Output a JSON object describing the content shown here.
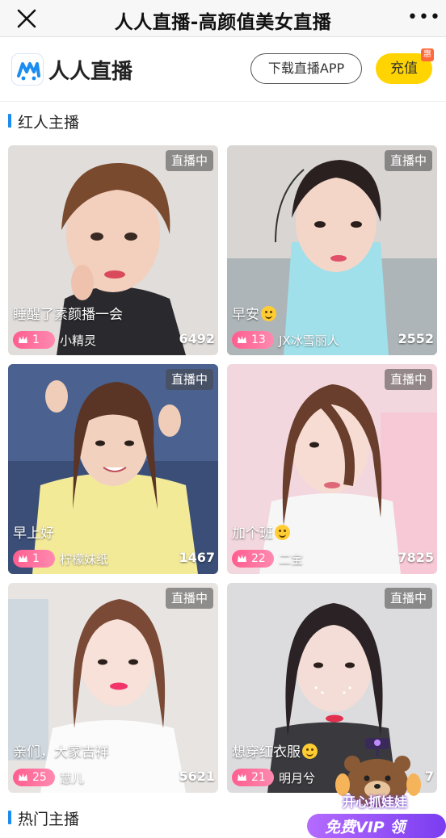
{
  "navbar": {
    "title": "人人直播-高颜值美女直播",
    "more_label": "•••"
  },
  "appbar": {
    "logo_text": "人人直播",
    "download_label": "下载直播APP",
    "recharge_label": "充值",
    "recharge_badge": "惠"
  },
  "sections": {
    "hot_red": "红人主播",
    "popular": "热门主播"
  },
  "cards": [
    {
      "status": "直播中",
      "caption": "睡醒了素颜播一会",
      "emoji": false,
      "level": "1",
      "name": "小精灵",
      "viewers": "6492"
    },
    {
      "status": "直播中",
      "caption": "早安",
      "emoji": true,
      "level": "13",
      "name": "JX冰雪丽人",
      "viewers": "2552"
    },
    {
      "status": "直播中",
      "caption": "早上好",
      "emoji": false,
      "level": "1",
      "name": "柠檬妹纸",
      "viewers": "1467"
    },
    {
      "status": "直播中",
      "caption": "加个班",
      "emoji": true,
      "level": "22",
      "name": "二宝",
      "viewers": "7825"
    },
    {
      "status": "直播中",
      "caption": "亲们，大家吉祥",
      "emoji": false,
      "level": "25",
      "name": "慧儿",
      "viewers": "5621"
    },
    {
      "status": "直播中",
      "caption": "想穿红衣服",
      "emoji": true,
      "level": "21",
      "name": "明月兮",
      "viewers": "7"
    }
  ],
  "promo": {
    "title": "开心抓娃娃",
    "vip_label": "免费VIP 领"
  },
  "colors": {
    "accent_blue": "#1c8cf0",
    "recharge_yellow": "#ffd400",
    "level_pink": "#ff5d8f",
    "promo_purple": "#8a45f5"
  }
}
